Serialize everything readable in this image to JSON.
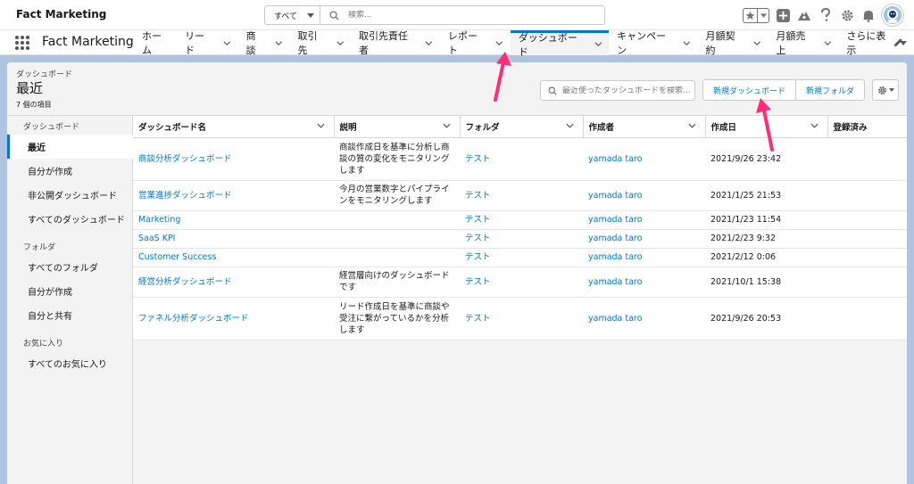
{
  "header": {
    "app_title": "Fact Marketing",
    "search_scope": "すべて",
    "search_placeholder": "検索..."
  },
  "nav": {
    "app_name": "Fact Marketing",
    "items": [
      {
        "label": "ホーム",
        "chevron": false
      },
      {
        "label": "リード",
        "chevron": true
      },
      {
        "label": "商談",
        "chevron": true
      },
      {
        "label": "取引先",
        "chevron": true
      },
      {
        "label": "取引先責任者",
        "chevron": true
      },
      {
        "label": "レポート",
        "chevron": true
      },
      {
        "label": "ダッシュボード",
        "chevron": true,
        "active": true
      },
      {
        "label": "キャンペーン",
        "chevron": true
      },
      {
        "label": "月額契約",
        "chevron": true
      },
      {
        "label": "月額売上",
        "chevron": true
      },
      {
        "label": "さらに表示",
        "chevron": false,
        "more": true
      }
    ]
  },
  "list_header": {
    "object_label": "ダッシュボード",
    "view_title": "最近",
    "item_count": "7 個の項目",
    "search_placeholder": "最近使ったダッシュボードを検索...",
    "new_dashboard": "新規ダッシュボード",
    "new_folder": "新規フォルダ"
  },
  "sidebar": {
    "section_dashboard": "ダッシュボード",
    "dashboard_items": [
      "最近",
      "自分が作成",
      "非公開ダッシュボード",
      "すべてのダッシュボード"
    ],
    "section_folder": "フォルダ",
    "folder_items": [
      "すべてのフォルダ",
      "自分が作成",
      "自分と共有"
    ],
    "section_favorite": "お気に入り",
    "favorite_items": [
      "すべてのお気に入り"
    ]
  },
  "table": {
    "columns": [
      "ダッシュボード名",
      "説明",
      "フォルダ",
      "作成者",
      "作成日",
      "登録済み"
    ],
    "rows": [
      {
        "name": "商談分析ダッシュボード",
        "desc": "商談作成日を基準に分析し商談の質の変化をモニタリングします",
        "folder": "テスト",
        "owner": "yamada taro",
        "date": "2021/9/26 23:42"
      },
      {
        "name": "営業進捗ダッシュボード",
        "desc": "今月の営業数字とパイプラインをモニタリングします",
        "folder": "テスト",
        "owner": "yamada taro",
        "date": "2021/1/25 21:53"
      },
      {
        "name": "Marketing",
        "desc": "",
        "folder": "テスト",
        "owner": "yamada taro",
        "date": "2021/1/23 11:54"
      },
      {
        "name": "SaaS KPI",
        "desc": "",
        "folder": "テスト",
        "owner": "yamada taro",
        "date": "2021/2/23 9:32"
      },
      {
        "name": "Customer Success",
        "desc": "",
        "folder": "テスト",
        "owner": "yamada taro",
        "date": "2021/2/12 0:06"
      },
      {
        "name": "経営分析ダッシュボード",
        "desc": "経営層向けのダッシュボードです",
        "folder": "テスト",
        "owner": "yamada taro",
        "date": "2021/10/1 15:38"
      },
      {
        "name": "ファネル分析ダッシュボード",
        "desc": "リード作成日を基準に商談や受注に繋がっているかを分析します",
        "folder": "テスト",
        "owner": "yamada taro",
        "date": "2021/9/26 20:53"
      }
    ]
  },
  "colors": {
    "brand_blue": "#0176d3",
    "annotation_pink": "#ff2d7a",
    "background": "#b0c4df"
  }
}
